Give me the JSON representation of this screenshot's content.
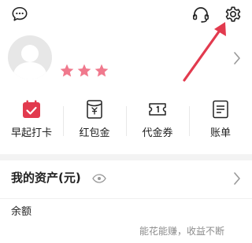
{
  "colors": {
    "accent_red": "#e23a4e",
    "star_pink": "#f0798d",
    "text_primary": "#222222",
    "text_secondary": "#8c8c8c",
    "page_bg": "#f3f3f3"
  },
  "header": {
    "left_icon": "chat-bubble-icon",
    "right_icons": [
      "headset-icon",
      "gear-icon"
    ]
  },
  "profile": {
    "avatar_icon": "default-avatar-icon",
    "stars": 3,
    "chevron_icon": "chevron-right-icon"
  },
  "menu": {
    "items": [
      {
        "label": "早起打卡",
        "icon": "calendar-checkin-icon"
      },
      {
        "label": "红包金",
        "icon": "red-envelope-icon"
      },
      {
        "label": "代金券",
        "icon": "voucher-icon"
      },
      {
        "label": "账单",
        "icon": "bill-icon"
      }
    ]
  },
  "assets": {
    "title": "我的资产(元)",
    "eye_icon": "eye-icon",
    "chevron_icon": "chevron-right-icon",
    "balance_label": "余额",
    "tagline": "能花能赚，收益不断"
  },
  "annotation": {
    "arrow_icon": "red-arrow-pointer-icon"
  }
}
